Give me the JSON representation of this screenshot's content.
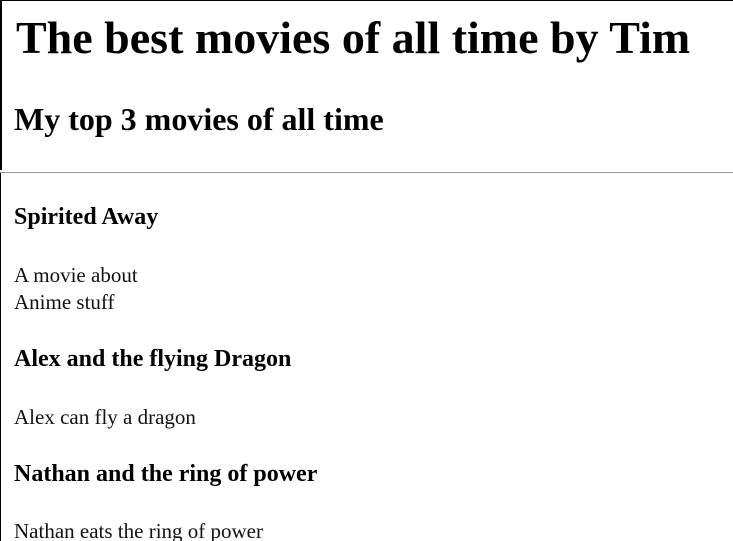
{
  "header": {
    "title": "The best movies of all time by Tim",
    "subtitle": "My top 3 movies of all time"
  },
  "movies": [
    {
      "title": "Spirited Away",
      "description_line1": "A movie about",
      "description_line2": "Anime stuff"
    },
    {
      "title": "Alex and the flying Dragon",
      "description_line1": "Alex can fly a dragon"
    },
    {
      "title": "Nathan and the ring of power",
      "description_line1": "Nathan eats the ring of power"
    }
  ]
}
